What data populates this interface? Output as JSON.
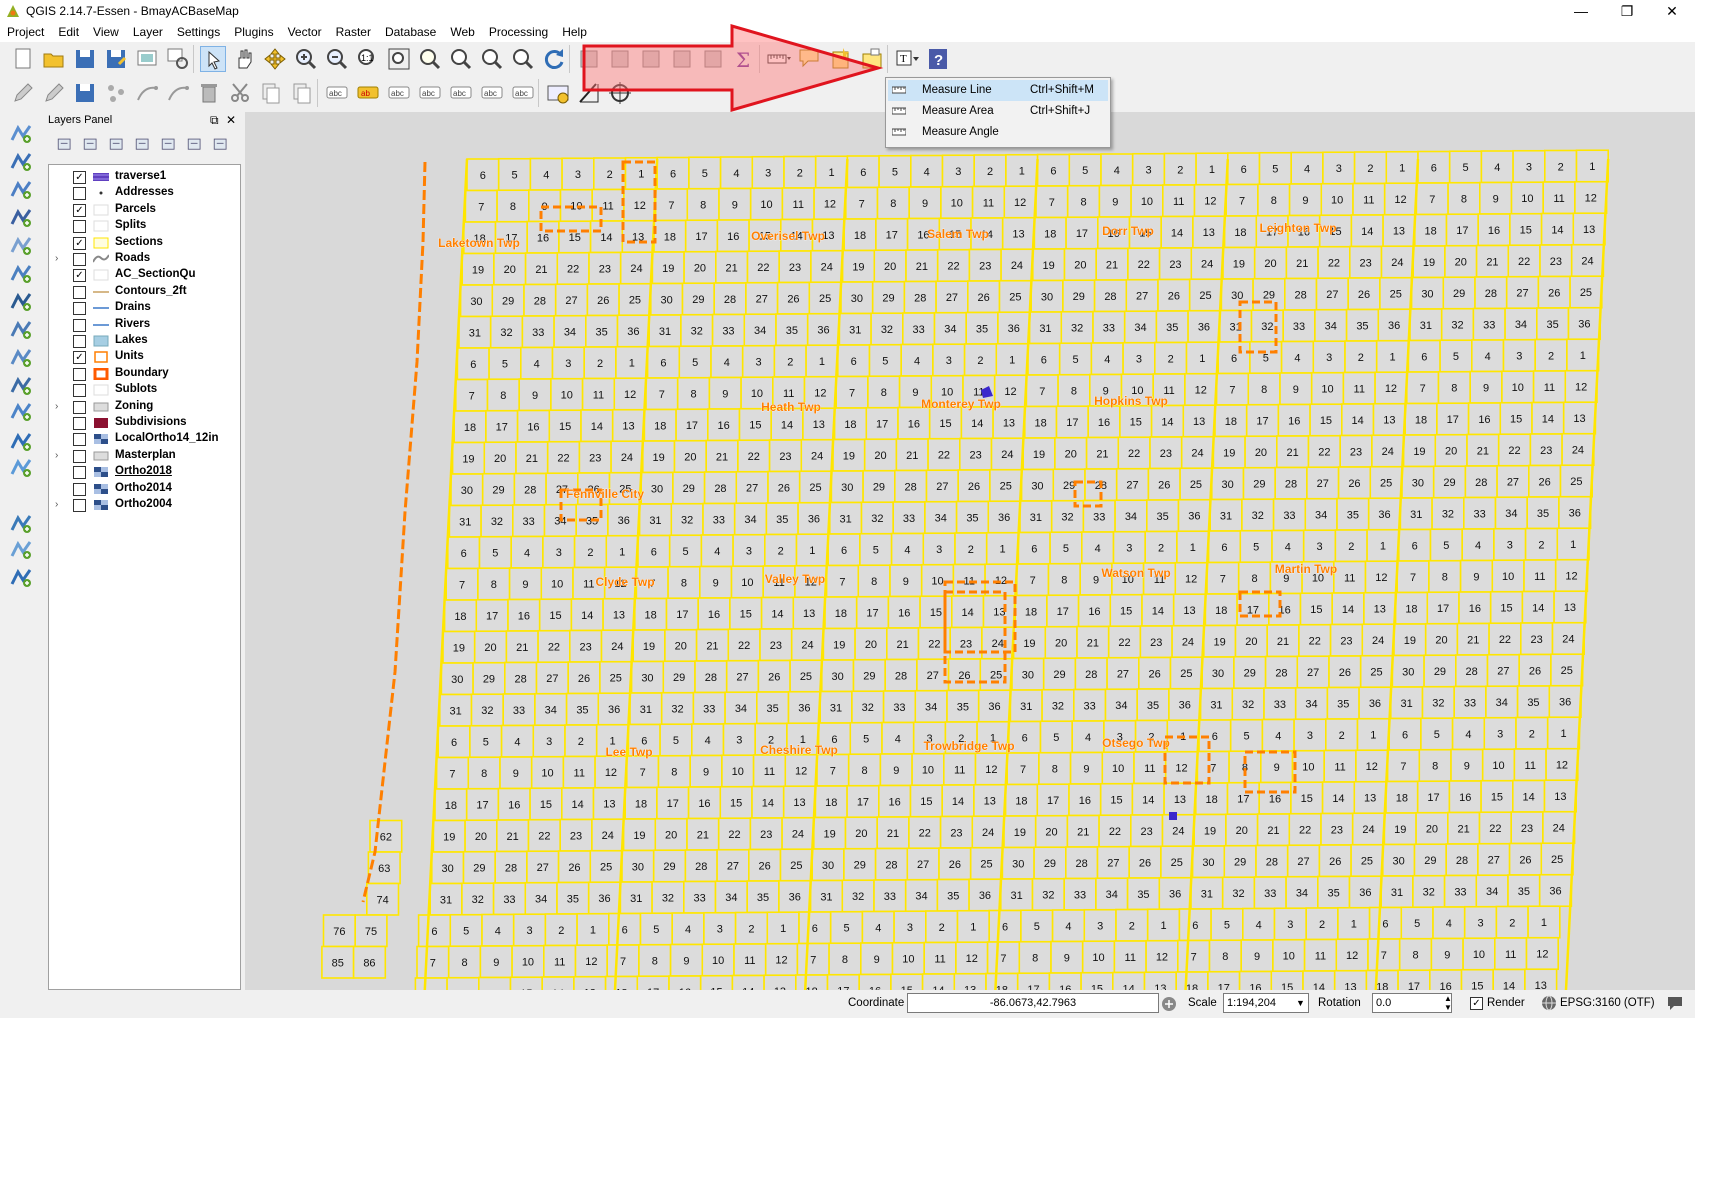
{
  "window": {
    "title": "QGIS 2.14.7-Essen - BmayACBaseMap",
    "buttons": {
      "minimize": "—",
      "restore": "❐",
      "close": "✕"
    }
  },
  "menu": [
    "Project",
    "Edit",
    "View",
    "Layer",
    "Settings",
    "Plugins",
    "Vector",
    "Raster",
    "Database",
    "Web",
    "Processing",
    "Help"
  ],
  "toolbar_icons": {
    "row1": [
      "new-project",
      "open-project",
      "save-project",
      "save-as",
      "print-composer",
      "composer-manager",
      "pan-to-selection",
      "pan",
      "pan-map",
      "zoom-in",
      "zoom-out",
      "zoom-native",
      "zoom-full",
      "zoom-layer",
      "zoom-selection",
      "zoom-last",
      "zoom-next",
      "refresh",
      "identify",
      "select",
      "deselect",
      "attribute-table",
      "field-calculator",
      "statistics-sum",
      "measure",
      "map-tips",
      "new-bookmark",
      "show-bookmarks",
      "text-annotation",
      "help"
    ],
    "row2": [
      "current-edits",
      "toggle-editing",
      "save-edits",
      "add-feature",
      "move-feature",
      "node-tool",
      "delete-selected",
      "cut-features",
      "copy-features",
      "paste-features",
      "label-toolbar",
      "layer-labeling",
      "pin-labels",
      "show-hide-labels",
      "move-label",
      "rotate-label",
      "change-label",
      "georeferencer",
      "measure-line-small",
      "coordinate-capture"
    ]
  },
  "measure_menu": {
    "items": [
      {
        "label": "Measure Line",
        "shortcut": "Ctrl+Shift+M",
        "highlighted": true
      },
      {
        "label": "Measure Area",
        "shortcut": "Ctrl+Shift+J",
        "highlighted": false
      },
      {
        "label": "Measure Angle",
        "shortcut": "",
        "highlighted": false
      }
    ]
  },
  "layers_panel": {
    "title": "Layers Panel",
    "layers": [
      {
        "name": "traverse1",
        "checked": true,
        "expandable": false,
        "symbol": "line-purple",
        "underline": false
      },
      {
        "name": "Addresses",
        "checked": false,
        "expandable": false,
        "symbol": "point",
        "underline": false
      },
      {
        "name": "Parcels",
        "checked": true,
        "expandable": false,
        "symbol": "fill-white",
        "underline": false
      },
      {
        "name": "Splits",
        "checked": false,
        "expandable": false,
        "symbol": "fill-white",
        "underline": false
      },
      {
        "name": "Sections",
        "checked": true,
        "expandable": false,
        "symbol": "fill-yellow",
        "underline": false
      },
      {
        "name": "Roads",
        "checked": false,
        "expandable": true,
        "symbol": "road",
        "underline": false
      },
      {
        "name": "AC_SectionQu",
        "checked": true,
        "expandable": false,
        "symbol": "fill-white",
        "underline": false
      },
      {
        "name": "Contours_2ft",
        "checked": false,
        "expandable": false,
        "symbol": "line-tan",
        "underline": false
      },
      {
        "name": "Drains",
        "checked": false,
        "expandable": false,
        "symbol": "line-blue",
        "underline": false
      },
      {
        "name": "Rivers",
        "checked": false,
        "expandable": false,
        "symbol": "line-blue",
        "underline": false
      },
      {
        "name": "Lakes",
        "checked": false,
        "expandable": false,
        "symbol": "fill-lightblue",
        "underline": false
      },
      {
        "name": "Units",
        "checked": true,
        "expandable": false,
        "symbol": "outline-orange",
        "underline": false
      },
      {
        "name": "Boundary",
        "checked": false,
        "expandable": false,
        "symbol": "outline-orange-thick",
        "underline": false
      },
      {
        "name": "Sublots",
        "checked": false,
        "expandable": false,
        "symbol": "fill-white",
        "underline": false
      },
      {
        "name": "Zoning",
        "checked": false,
        "expandable": true,
        "symbol": "zone",
        "underline": false
      },
      {
        "name": "Subdivisions",
        "checked": false,
        "expandable": false,
        "symbol": "fill-maroon",
        "underline": false
      },
      {
        "name": "LocalOrtho14_12in",
        "checked": false,
        "expandable": false,
        "symbol": "raster",
        "underline": false
      },
      {
        "name": "Masterplan",
        "checked": false,
        "expandable": true,
        "symbol": "zone",
        "underline": false
      },
      {
        "name": "Ortho2018",
        "checked": false,
        "expandable": false,
        "symbol": "raster",
        "underline": true
      },
      {
        "name": "Ortho2014",
        "checked": false,
        "expandable": false,
        "symbol": "raster",
        "underline": false
      },
      {
        "name": "Ortho2004",
        "checked": false,
        "expandable": true,
        "symbol": "raster",
        "underline": false
      }
    ]
  },
  "map": {
    "background": "#d9d9d9",
    "section_fill": "#dcdcdc",
    "section_stroke": "#ffe600",
    "boundary_color": "#ff7f00",
    "label_color": "#ff7f00",
    "section_order": [
      6,
      5,
      4,
      3,
      2,
      1,
      7,
      8,
      9,
      10,
      11,
      12,
      18,
      17,
      16,
      15,
      14,
      13,
      19,
      20,
      21,
      22,
      23,
      24,
      30,
      29,
      28,
      27,
      26,
      25,
      31,
      32,
      33,
      34,
      35,
      36
    ],
    "township_labels": [
      "Laketown Twp",
      "Overisel Twp",
      "Salem Twp",
      "Dorr Twp",
      "Leighton Twp",
      "Heath Twp",
      "Monterey Twp",
      "Hopkins Twp",
      "Fennville City",
      "Clyde Twp",
      "Valley Twp",
      "Watson Twp",
      "Martin Twp",
      "Lee Twp",
      "Cheshire Twp",
      "Trowbridge Twp",
      "Otsego Twp"
    ],
    "extra_labels": [
      "62",
      "63",
      "74",
      "76",
      "75",
      "85",
      "86"
    ]
  },
  "status_bar": {
    "coordinate_label": "Coordinate",
    "coordinate_value": "-86.0673,42.7963",
    "scale_label": "Scale",
    "scale_value": "1:194,204",
    "rotation_label": "Rotation",
    "rotation_value": "0.0",
    "render_label": "Render",
    "render_checked": true,
    "crs": "EPSG:3160 (OTF)"
  }
}
